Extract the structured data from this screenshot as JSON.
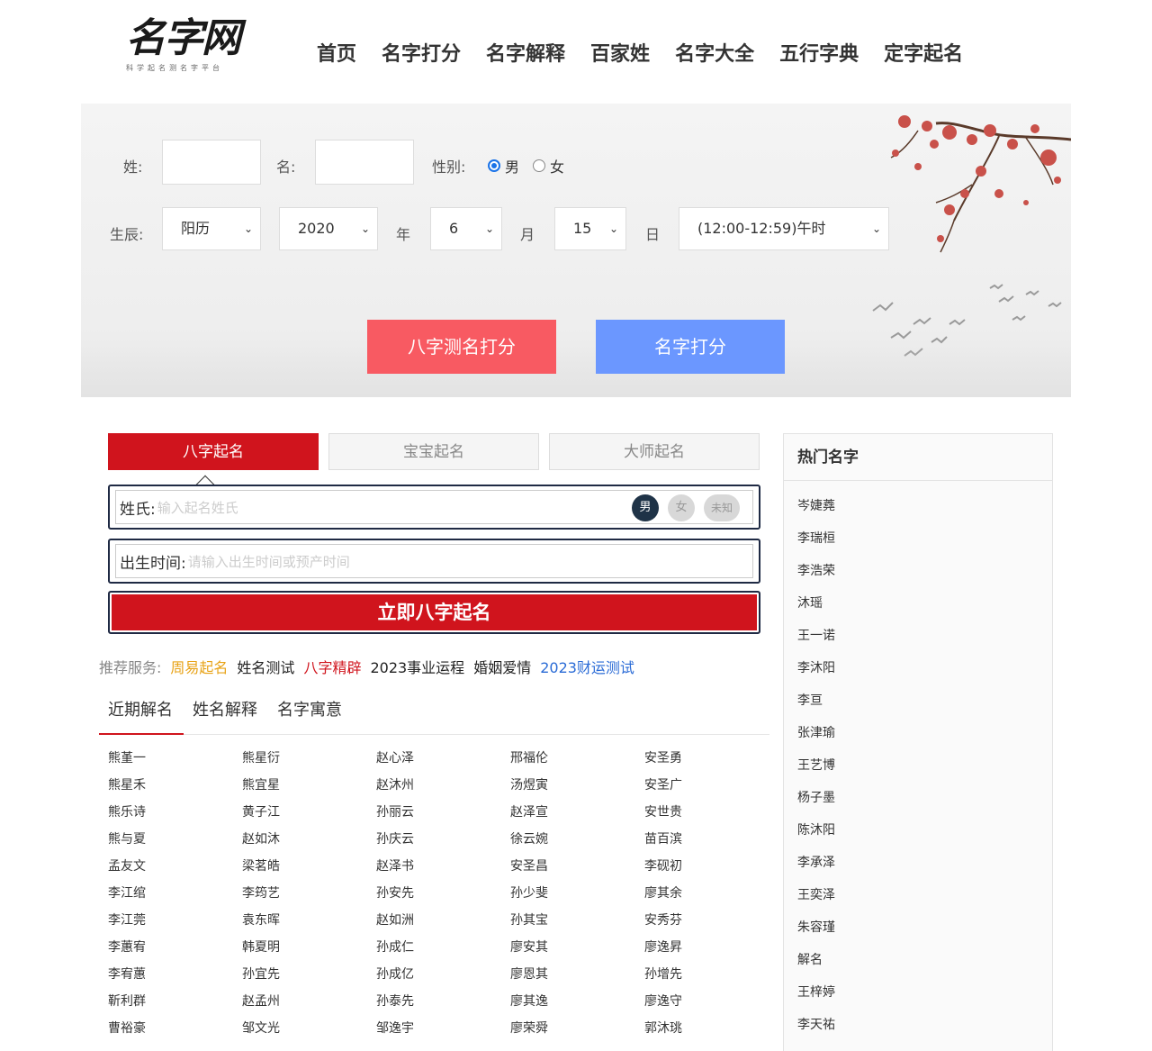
{
  "header": {
    "logo_text": "名字网",
    "logo_sub": "科学起名测名字平台",
    "nav": [
      "首页",
      "名字打分",
      "名字解释",
      "百家姓",
      "名字大全",
      "五行字典",
      "定字起名"
    ]
  },
  "form": {
    "surname_label": "姓:",
    "name_label": "名:",
    "gender_label": "性别:",
    "gender_male": "男",
    "gender_female": "女",
    "birth_label": "生辰:",
    "calendar": "阳历",
    "year": "2020",
    "year_unit": "年",
    "month": "6",
    "month_unit": "月",
    "day": "15",
    "day_unit": "日",
    "hour": "(12:00-12:59)午时",
    "btn_bazi": "八字测名打分",
    "btn_score": "名字打分",
    "colors": {
      "btn_bazi": "#f85a62",
      "btn_score": "#6b97ff"
    }
  },
  "naming": {
    "tabs": [
      "八字起名",
      "宝宝起名",
      "大师起名"
    ],
    "surname_label": "姓氏:",
    "surname_placeholder": "输入起名姓氏",
    "gender_options": [
      "男",
      "女",
      "未知"
    ],
    "birth_label": "出生时间:",
    "birth_placeholder": "请输入出生时间或预产时间",
    "submit": "立即八字起名",
    "accent": "#d0141d"
  },
  "recommend": {
    "label": "推荐服务:",
    "items": [
      {
        "text": "周易起名",
        "color": "#e8a317"
      },
      {
        "text": "姓名测试",
        "color": "#222222"
      },
      {
        "text": "八字精辟",
        "color": "#d0141d"
      },
      {
        "text": "2023事业运程",
        "color": "#222222"
      },
      {
        "text": "婚姻爱情",
        "color": "#222222"
      },
      {
        "text": "2023财运测试",
        "color": "#2a6bd6"
      }
    ]
  },
  "sub_tabs": [
    "近期解名",
    "姓名解释",
    "名字寓意"
  ],
  "recent_names": [
    "熊堇一",
    "熊星衍",
    "赵心泽",
    "邢福伦",
    "安圣勇",
    "熊星禾",
    "熊宜星",
    "赵沐州",
    "汤煜寅",
    "安圣广",
    "熊乐诗",
    "黄子江",
    "孙丽云",
    "赵泽宣",
    "安世贵",
    "熊与夏",
    "赵如沐",
    "孙庆云",
    "徐云婉",
    "苗百滨",
    "孟友文",
    "梁茗皓",
    "赵泽书",
    "安圣昌",
    "李砚初",
    "李江绾",
    "李筠艺",
    "孙安先",
    "孙少斐",
    "廖其余",
    "李江莞",
    "袁东晖",
    "赵如洲",
    "孙其宝",
    "安秀芬",
    "李蕙宥",
    "韩夏明",
    "孙成仁",
    "廖安其",
    "廖逸昇",
    "李宥蕙",
    "孙宜先",
    "孙成亿",
    "廖恩其",
    "孙增先",
    "靳利群",
    "赵孟州",
    "孙泰先",
    "廖其逸",
    "廖逸守",
    "曹裕豪",
    "邹文光",
    "邹逸宇",
    "廖荣舜",
    "郭沐珧"
  ],
  "sidebar": {
    "title": "热门名字",
    "names": [
      "岑婕蕘",
      "李瑞桓",
      "李浩荣",
      "沐瑶",
      "王一诺",
      "李沐阳",
      "李亘",
      "张津瑜",
      "王艺博",
      "杨子墨",
      "陈沐阳",
      "李承泽",
      "王奕泽",
      "朱容瑾",
      "解名",
      "王梓婷",
      "李天祐"
    ]
  }
}
